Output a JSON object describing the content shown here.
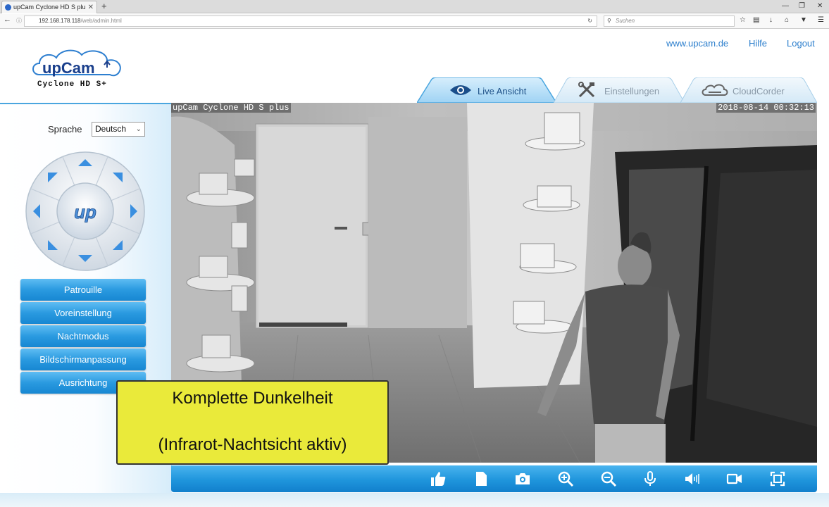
{
  "browser": {
    "tab_title": "upCam Cyclone HD S plu",
    "new_tab": "+",
    "url_host": "192.168.178.118",
    "url_path": "/web/admin.html",
    "search_placeholder": "Suchen",
    "tab_close": "✕",
    "minimize": "—",
    "maximize": "❐",
    "close": "✕"
  },
  "header": {
    "logo_text": "upCam",
    "logo_subtitle": "Cyclone HD S+",
    "links": [
      {
        "label": "www.upcam.de"
      },
      {
        "label": "Hilfe"
      },
      {
        "label": "Logout"
      }
    ],
    "tabs": [
      {
        "label": "Live Ansicht",
        "active": true,
        "icon": "eye-icon"
      },
      {
        "label": "Einstellungen",
        "active": false,
        "icon": "tools-icon"
      },
      {
        "label": "CloudCorder",
        "active": false,
        "icon": "cloud-icon"
      }
    ]
  },
  "sidebar": {
    "language_label": "Sprache",
    "language_value": "Deutsch",
    "ptz_logo": "up",
    "buttons": [
      {
        "label": "Patrouille"
      },
      {
        "label": "Voreinstellung"
      },
      {
        "label": "Nachtmodus"
      },
      {
        "label": "Bildschirmanpassung"
      },
      {
        "label": "Ausrichtung"
      }
    ]
  },
  "video": {
    "osd_name": "upCam Cyclone HD S plus",
    "osd_timestamp": "2018-08-14 00:32:13"
  },
  "annotation": {
    "line1": "Komplette Dunkelheit",
    "line2": "(Infrarot-Nachtsicht aktiv)"
  },
  "toolbar": {
    "icons": [
      "thumbs-up-icon",
      "record-file-icon",
      "snapshot-icon",
      "zoom-in-icon",
      "zoom-out-icon",
      "microphone-icon",
      "speaker-icon",
      "video-record-icon",
      "fullscreen-icon"
    ]
  },
  "colors": {
    "accent_blue": "#2a9ae0",
    "link_blue": "#2d7fcd",
    "annotation_yellow": "#eaea3a"
  }
}
